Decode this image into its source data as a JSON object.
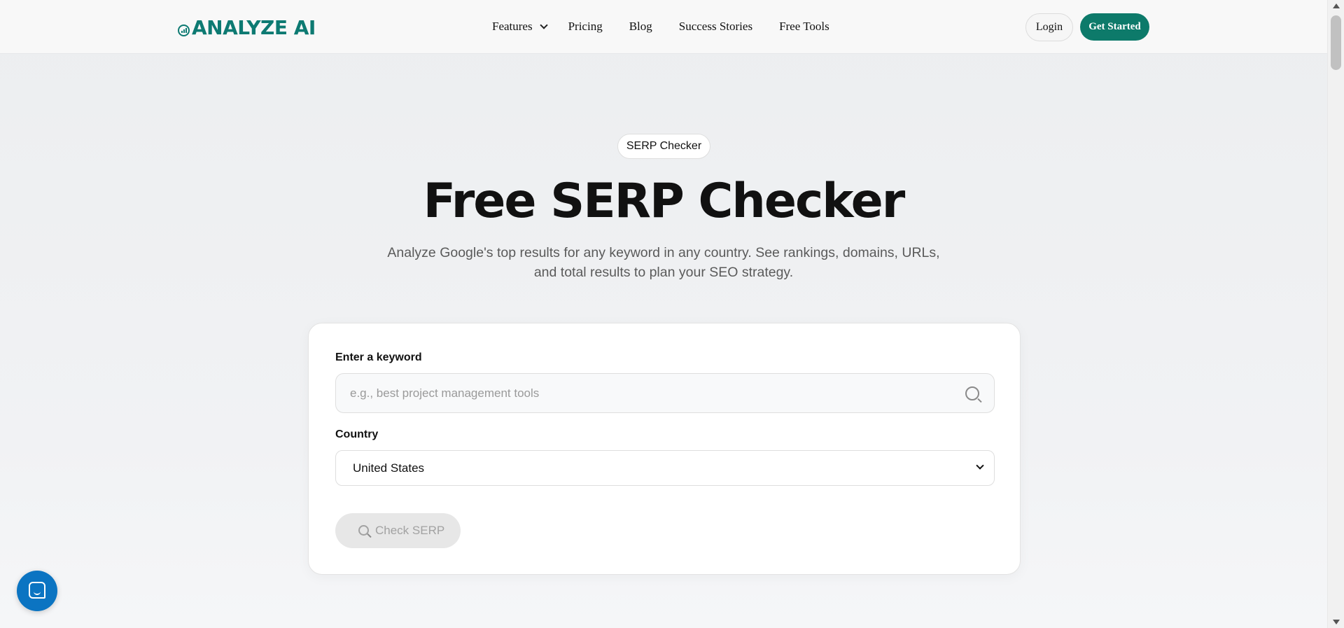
{
  "header": {
    "logo_text": "ANALYZE AI",
    "nav": [
      {
        "label": "Features",
        "has_dropdown": true
      },
      {
        "label": "Pricing"
      },
      {
        "label": "Blog"
      },
      {
        "label": "Success Stories"
      },
      {
        "label": "Free Tools"
      }
    ],
    "login_label": "Login",
    "get_started_label": "Get Started"
  },
  "hero": {
    "badge": "SERP Checker",
    "title": "Free SERP Checker",
    "subtitle_line1": "Analyze Google's top results for any keyword in any country. See rankings, domains, URLs,",
    "subtitle_line2": "and total results to plan your SEO strategy."
  },
  "form": {
    "keyword_label": "Enter a keyword",
    "keyword_value": "",
    "keyword_placeholder": "e.g., best project management tools",
    "country_label": "Country",
    "country_selected": "United States",
    "submit_label": "Check SERP",
    "submit_disabled": true
  },
  "icons": {
    "search": "search-icon",
    "chat": "chat-icon",
    "dropdown": "chevron-down-icon"
  },
  "colors": {
    "brand": "#0d7a72",
    "primary_button": "#0d7a6a",
    "chat_widget": "#0b74c2",
    "disabled_button": "#e7e7e7"
  }
}
